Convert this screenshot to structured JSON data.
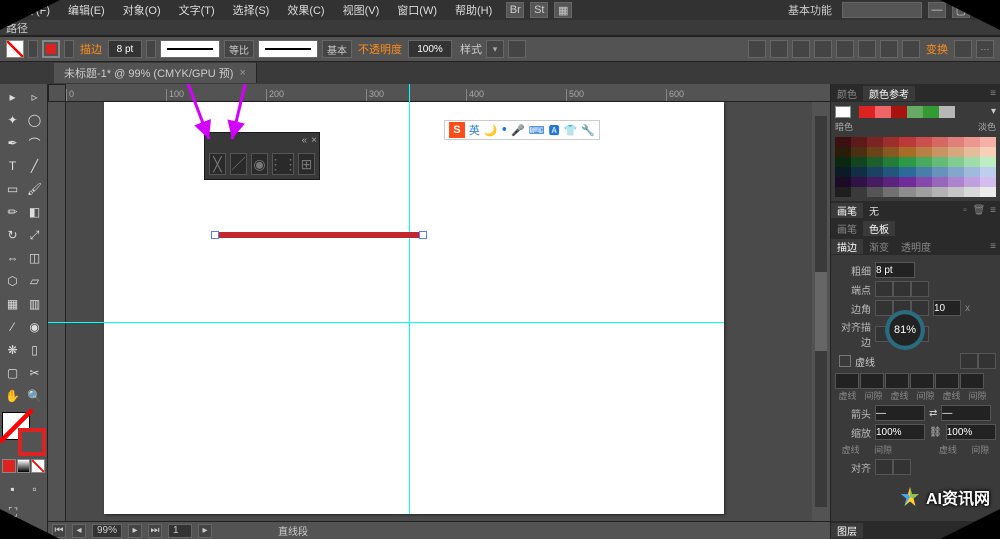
{
  "menu": {
    "items": [
      "文件(F)",
      "编辑(E)",
      "对象(O)",
      "文字(T)",
      "选择(S)",
      "效果(C)",
      "视图(V)",
      "窗口(W)",
      "帮助(H)"
    ],
    "workspace_label": "基本功能"
  },
  "control_row": {
    "label": "路径"
  },
  "options": {
    "stroke_label": "描边",
    "stroke_weight": "8 pt",
    "profile_label": "等比",
    "brush_label": "基本",
    "opacity_label": "不透明度",
    "opacity_value": "100%",
    "style_label": "样式",
    "transform_label": "变换"
  },
  "tab": {
    "title": "未标题-1* @ 99% (CMYK/GPU 预)"
  },
  "ruler": {
    "marks": [
      "0",
      "100",
      "200",
      "300",
      "400",
      "500",
      "600"
    ]
  },
  "status": {
    "zoom": "99%",
    "artboard_nav": "1",
    "selection_label": "直线段"
  },
  "ime": {
    "lang": "英",
    "icons": [
      "🌙",
      "🎤",
      "⌨",
      "🅰",
      "👕",
      "🔧"
    ]
  },
  "right": {
    "color_tabs": [
      "颜色",
      "颜色参考"
    ],
    "color_labels": {
      "dark": "暗色",
      "light": "淡色"
    },
    "brush_tabs": [
      "画笔"
    ],
    "brush_none": "无",
    "swatch_tabs": [
      "画笔",
      "色板"
    ],
    "stroke_tabs": [
      "描边",
      "渐变",
      "透明度"
    ],
    "stroke": {
      "weight_label": "粗细",
      "weight_value": "8 pt",
      "cap_label": "端点",
      "corner_label": "边角",
      "corner_limit": "10",
      "align_label": "对齐描边",
      "dash_label": "虚线",
      "dash_cols": [
        "虚线",
        "间隙",
        "虚线",
        "间隙",
        "虚线",
        "间隙"
      ],
      "arrow_label": "箭头",
      "scale_label": "缩放",
      "scale_a": "100%",
      "scale_b": "100%",
      "align2_label": "对齐"
    },
    "bottom_tabs": [
      "图层"
    ]
  },
  "dial": {
    "value": "81%"
  },
  "watermark": {
    "text": "AI资讯网"
  }
}
